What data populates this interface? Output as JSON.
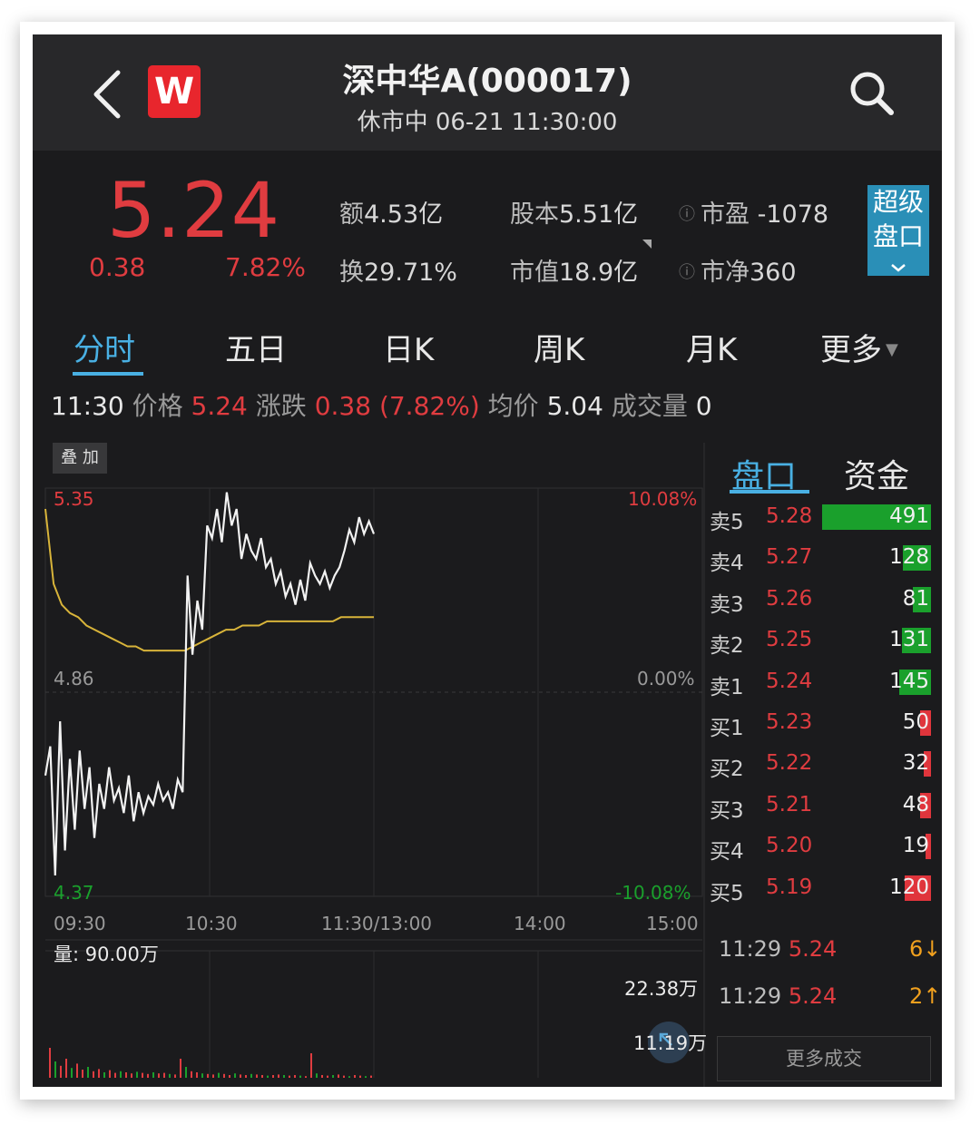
{
  "header": {
    "back_icon": "chevron-left-icon",
    "logo_text": "W",
    "title": "深中华A(000017)",
    "subtitle": "休市中 06-21 11:30:00",
    "search_icon": "search-icon"
  },
  "quote": {
    "price": "5.24",
    "change": "0.38",
    "change_pct": "7.82%",
    "amount_label": "额",
    "amount_value": "4.53亿",
    "turnover_label": "换",
    "turnover_value": "29.71%",
    "capital_label": "股本",
    "capital_value": "5.51亿",
    "mktcap_label": "市值",
    "mktcap_value": "18.9亿",
    "pe_label": "市盈",
    "pe_value": "-1078",
    "pb_label": "市净",
    "pb_value": "360",
    "super_line1": "超级",
    "super_line2": "盘口"
  },
  "tabs": [
    "分时",
    "五日",
    "日K",
    "周K",
    "月K",
    "更多"
  ],
  "active_tab": "分时",
  "quote_line": {
    "time": "11:30",
    "price_label": "价格",
    "price": "5.24",
    "chg_label": "涨跌",
    "chg": "0.38 (7.82%)",
    "avg_label": "均价",
    "avg": "5.04",
    "vol_label": "成交量",
    "vol": "0"
  },
  "chart": {
    "overlay_button": "叠 加",
    "y_left_top": "5.35",
    "y_left_mid": "4.86",
    "y_left_bot": "4.37",
    "y_right_top": "10.08%",
    "y_right_mid": "0.00%",
    "y_right_bot": "-10.08%",
    "x_labels": [
      "09:30",
      "10:30",
      "11:30/13:00",
      "14:00",
      "15:00"
    ],
    "volume_label": "量: 90.00万",
    "vol_axis_top": "22.38万",
    "vol_axis_mid": "11.19万"
  },
  "chart_data": {
    "type": "line",
    "title": "",
    "ylim": [
      4.37,
      5.35
    ],
    "pct_range": [
      "-10.08%",
      "10.08%"
    ],
    "prev_close": 4.86,
    "x_range": [
      "09:30",
      "15:00"
    ],
    "series": [
      {
        "name": "价格",
        "color": "#f2f2f2",
        "values": [
          4.66,
          4.73,
          4.42,
          4.79,
          4.48,
          4.7,
          4.53,
          4.72,
          4.58,
          4.68,
          4.51,
          4.64,
          4.58,
          4.68,
          4.6,
          4.63,
          4.57,
          4.66,
          4.55,
          4.62,
          4.57,
          4.61,
          4.59,
          4.64,
          4.6,
          4.62,
          4.58,
          4.65,
          4.62,
          5.14,
          4.95,
          5.08,
          5.01,
          5.26,
          5.23,
          5.3,
          5.22,
          5.34,
          5.26,
          5.3,
          5.18,
          5.24,
          5.2,
          5.18,
          5.23,
          5.16,
          5.18,
          5.12,
          5.15,
          5.09,
          5.12,
          5.07,
          5.13,
          5.08,
          5.17,
          5.14,
          5.12,
          5.15,
          5.11,
          5.14,
          5.16,
          5.2,
          5.25,
          5.22,
          5.28,
          5.24,
          5.27,
          5.24
        ]
      },
      {
        "name": "均价",
        "color": "#d8b43a",
        "values": [
          5.3,
          5.12,
          5.07,
          5.05,
          5.04,
          5.02,
          5.01,
          5.0,
          4.99,
          4.98,
          4.97,
          4.97,
          4.96,
          4.96,
          4.96,
          4.96,
          4.96,
          4.96,
          4.97,
          4.98,
          4.99,
          5.0,
          5.01,
          5.01,
          5.02,
          5.02,
          5.02,
          5.03,
          5.03,
          5.03,
          5.03,
          5.03,
          5.03,
          5.03,
          5.03,
          5.03,
          5.04,
          5.04,
          5.04,
          5.04,
          5.04
        ]
      }
    ]
  },
  "order_book": {
    "tabs": [
      "盘口",
      "资金"
    ],
    "max_vol": 491,
    "asks": [
      {
        "label": "卖5",
        "price": "5.28",
        "vol": 491
      },
      {
        "label": "卖4",
        "price": "5.27",
        "vol": 128
      },
      {
        "label": "卖3",
        "price": "5.26",
        "vol": 81
      },
      {
        "label": "卖2",
        "price": "5.25",
        "vol": 131
      },
      {
        "label": "卖1",
        "price": "5.24",
        "vol": 145
      }
    ],
    "bids": [
      {
        "label": "买1",
        "price": "5.23",
        "vol": 50
      },
      {
        "label": "买2",
        "price": "5.22",
        "vol": 32
      },
      {
        "label": "买3",
        "price": "5.21",
        "vol": 48
      },
      {
        "label": "买4",
        "price": "5.20",
        "vol": 19
      },
      {
        "label": "买5",
        "price": "5.19",
        "vol": 120
      }
    ],
    "ask_color": "#1aa02c",
    "bid_color": "#e0353c"
  },
  "ticks": [
    {
      "time": "11:29",
      "price": "5.24",
      "vol": "6↓"
    },
    {
      "time": "11:29",
      "price": "5.24",
      "vol": "2↑"
    }
  ],
  "more_trades": "更多成交"
}
